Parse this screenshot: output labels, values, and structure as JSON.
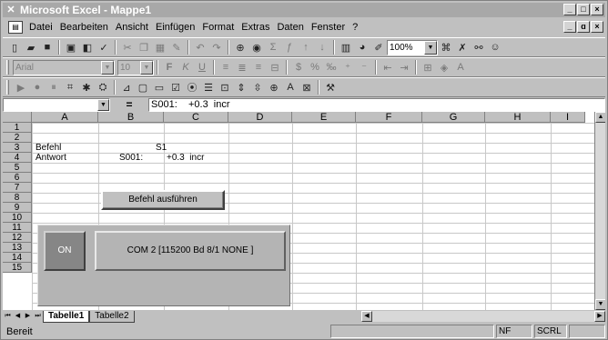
{
  "window": {
    "title": "Microsoft Excel - Mappe1",
    "controls": [
      "_",
      "□",
      "×"
    ]
  },
  "menu": {
    "items": [
      "Datei",
      "Bearbeiten",
      "Ansicht",
      "Einfügen",
      "Format",
      "Extras",
      "Daten",
      "Fenster",
      "?"
    ],
    "doc_controls": [
      "_",
      "ɑ",
      "×"
    ]
  },
  "toolbar_standard": {
    "zoom": "100%"
  },
  "toolbar_format": {
    "font": "Arial",
    "size": "10",
    "bold": "F",
    "italic": "K",
    "underline": "U"
  },
  "formula_bar": {
    "name_box": "",
    "equals": "=",
    "content": "S001:    +0.3  incr"
  },
  "columns": [
    "A",
    "B",
    "C",
    "D",
    "E",
    "F",
    "G",
    "H",
    "I"
  ],
  "rows": [
    "1",
    "2",
    "3",
    "4",
    "5",
    "6",
    "7",
    "8",
    "9",
    "10",
    "11",
    "12",
    "13",
    "14",
    "15"
  ],
  "cells": {
    "a2": "Befehl",
    "c2": "S1",
    "a3": "Antwort",
    "b3": "S001:",
    "c3": "+0.3  incr"
  },
  "controls": {
    "execute_button": "Befehl ausführen",
    "on_button": "ON",
    "com_button": "COM 2 [115200 Bd 8/1 NONE ]"
  },
  "sheet_tabs": [
    "Tabelle1",
    "Tabelle2"
  ],
  "status_bar": {
    "text": "Bereit",
    "nf": "NF",
    "scrl": "SCRL"
  }
}
